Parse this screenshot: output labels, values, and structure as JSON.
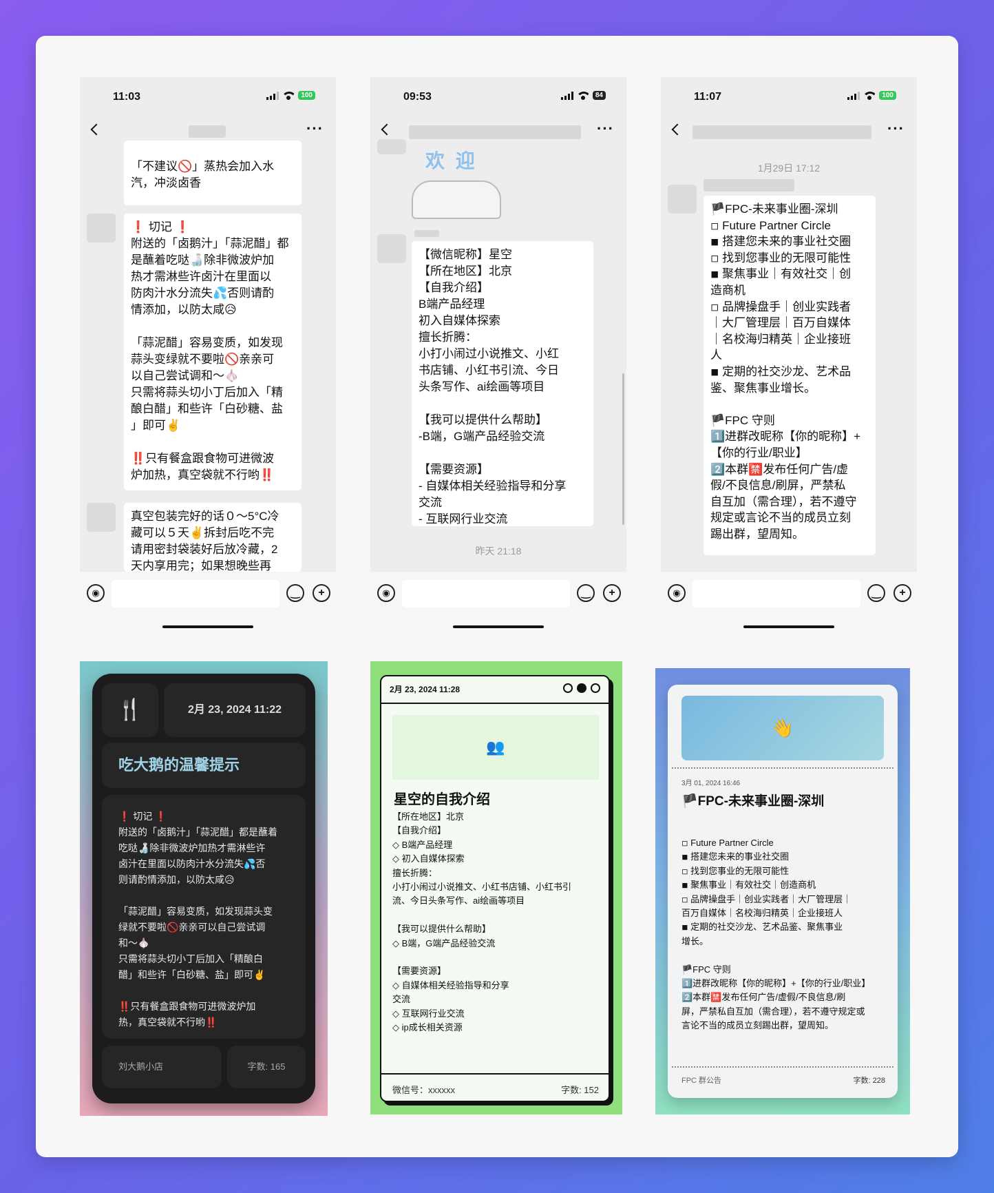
{
  "shot1": {
    "time": "11:03",
    "battery": "100",
    "bubble_a": "「不建议🚫」蒸热会加入水\n汽，冲淡卤香",
    "bubble_b": "❗ 切记 ❗\n附送的「卤鹅汁」「蒜泥醋」都\n是蘸着吃哒🍶除非微波炉加\n热才需淋些许卤汁在里面以\n防肉汁水分流失💦否则请酌\n情添加，以防太咸😥\n\n「蒜泥醋」容易变质，如发现\n蒜头变绿就不要啦🚫亲亲可\n以自己尝试调和～🧄\n只需将蒜头切小丁后加入「精\n酿白醋」和些许「白砂糖、盐\n」即可✌️\n\n‼️只有餐盒跟食物可进微波\n炉加热，真空袋就不行哟‼️",
    "bubble_c": "真空包装完好的话０～5°C冷\n藏可以５天✌️拆封后吃不完\n请用密封袋装好后放冷藏，2\n天内享用完；如果想晚些再"
  },
  "shot2": {
    "time": "09:53",
    "battery": "84",
    "sticker": "欢 迎",
    "bubble": "【微信昵称】星空\n【所在地区】北京\n【自我介绍】\nB端产品经理\n初入自媒体探索\n擅长折腾：\n小打小闹过小说推文、小红\n书店铺、小红书引流、今日\n头条写作、ai绘画等项目\n\n【我可以提供什么帮助】\n-B端，G端产品经验交流\n\n【需要资源】\n- 自媒体相关经验指导和分享\n交流\n- 互联网行业交流\n-ip成长相关资源",
    "timestamp": "昨天 21:18"
  },
  "shot3": {
    "time": "11:07",
    "battery": "100",
    "timestamp": "1月29日 17:12",
    "bubble": "🏴FPC-未来事业圈-深圳\n◽ Future Partner Circle\n◾ 搭建您未来的事业社交圈\n◽ 找到您事业的无限可能性\n◾ 聚焦事业｜有效社交｜创\n造商机\n◽ 品牌操盘手｜创业实践者\n｜大厂管理层｜百万自媒体\n｜名校海归精英｜企业接班\n人\n◾ 定期的社交沙龙、艺术品\n鉴、聚焦事业增长。\n\n🏴FPC 守则\n1️⃣进群改昵称【你的昵称】+\n【你的行业/职业】\n2️⃣本群🈲发布任何广告/虚\n假/不良信息/刷屏，严禁私\n自互加（需合理），若不遵守\n规定或言论不当的成员立刻\n踢出群，望周知。"
  },
  "card1": {
    "date": "2月 23, 2024 11:22",
    "title": "吃大鹅的温馨提示",
    "body": "❗ 切记 ❗\n附送的「卤鹅汁」「蒜泥醋」都是蘸着\n吃哒🍶除非微波炉加热才需淋些许\n卤汁在里面以防肉汁水分流失💦否\n则请酌情添加，以防太咸😥\n\n「蒜泥醋」容易变质，如发现蒜头变\n绿就不要啦🚫亲亲可以自己尝试调\n和～🧄\n只需将蒜头切小丁后加入「精酿白\n醋」和些许「白砂糖、盐」即可✌️\n\n‼️只有餐盒跟食物可进微波炉加\n热，真空袋就不行哟‼️",
    "footer_left": "刘大鹅小店",
    "footer_right": "字数: 165"
  },
  "card2": {
    "date": "2月 23, 2024 11:28",
    "title": "星空的自我介绍",
    "body": "【所在地区】北京\n【自我介绍】\n◇ B端产品经理\n◇ 初入自媒体探索\n擅长折腾：\n小打小闹过小说推文、小红书店铺、小红书引\n流、今日头条写作、ai绘画等项目\n\n【我可以提供什么帮助】\n◇ B端，G端产品经验交流\n\n【需要资源】\n◇ 自媒体相关经验指导和分享\n交流\n◇ 互联网行业交流\n◇ ip成长相关资源",
    "footer_left": "微信号：xxxxxx",
    "footer_right": "字数: 152"
  },
  "card3": {
    "date": "3月 01, 2024 16:46",
    "title": "🏴FPC-未来事业圈-深圳",
    "body": "◽ Future Partner Circle\n◾ 搭建您未来的事业社交圈\n◽ 找到您事业的无限可能性\n◾ 聚焦事业｜有效社交｜创造商机\n◽ 品牌操盘手｜创业实践者｜大厂管理层｜\n百万自媒体｜名校海归精英｜企业接班人\n◾ 定期的社交沙龙、艺术品鉴、聚焦事业\n增长。\n\n🏴FPC 守则\n1️⃣进群改昵称【你的昵称】+【你的行业/职业】\n2️⃣本群🈲发布任何广告/虚假/不良信息/刷\n屏，严禁私自互加（需合理），若不遵守规定或\n言论不当的成员立刻踢出群，望周知。",
    "footer_left": "FPC 群公告",
    "footer_right": "字数: 228"
  },
  "icons": {
    "fork": "🍴",
    "people": "👥",
    "wave": "👋",
    "voice": "🔊",
    "emoji": "😊",
    "plus": "+"
  }
}
